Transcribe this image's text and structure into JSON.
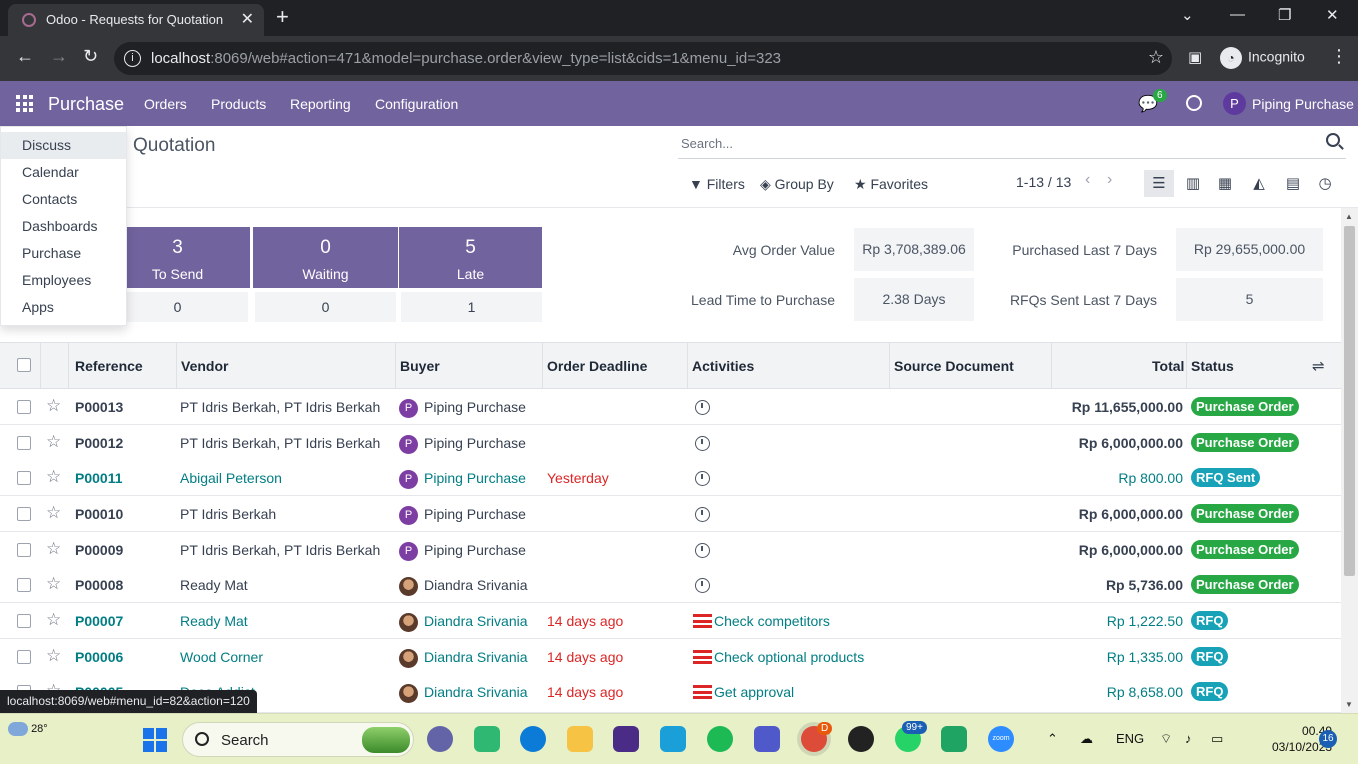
{
  "browser": {
    "tab_title": "Odoo - Requests for Quotation",
    "url_host": "localhost",
    "url_rest": ":8069/web#action=471&model=purchase.order&view_type=list&cids=1&menu_id=323",
    "profile_label": "Incognito",
    "link_preview": "localhost:8069/web#menu_id=82&action=120"
  },
  "navbar": {
    "app_name": "Purchase",
    "menu": [
      "Orders",
      "Products",
      "Reporting",
      "Configuration"
    ],
    "chat_count": "6",
    "user_initial": "P",
    "user_name": "Piping Purchase"
  },
  "apps_dropdown": [
    "Discuss",
    "Calendar",
    "Contacts",
    "Dashboards",
    "Purchase",
    "Employees",
    "Apps"
  ],
  "control_panel": {
    "title": "Quotation",
    "search_placeholder": "Search...",
    "filters": "Filters",
    "group_by": "Group By",
    "favorites": "Favorites",
    "pager": "1-13 / 13"
  },
  "dashboard": {
    "tiles": [
      {
        "value": "3",
        "label": "To Send",
        "sub": "0"
      },
      {
        "value": "0",
        "label": "Waiting",
        "sub": "0"
      },
      {
        "value": "5",
        "label": "Late",
        "sub": "1"
      }
    ],
    "kpis": [
      {
        "label": "Avg Order Value",
        "value": "Rp 3,708,389.06"
      },
      {
        "label": "Purchased Last 7 Days",
        "value": "Rp 29,655,000.00"
      },
      {
        "label": "Lead Time to Purchase",
        "value": "2.38 Days"
      },
      {
        "label": "RFQs Sent Last 7 Days",
        "value": "5"
      }
    ]
  },
  "table": {
    "columns": [
      "Reference",
      "Vendor",
      "Buyer",
      "Order Deadline",
      "Activities",
      "Source Document",
      "Total",
      "Status"
    ],
    "rows": [
      {
        "ref": "P00013",
        "vendor": "PT Idris Berkah, PT Idris Berkah",
        "buyer": "Piping Purchase",
        "deadline": "",
        "activity": "",
        "total": "Rp 11,655,000.00",
        "status": "Purchase Order"
      },
      {
        "ref": "P00012",
        "vendor": "PT Idris Berkah, PT Idris Berkah",
        "buyer": "Piping Purchase",
        "deadline": "",
        "activity": "",
        "total": "Rp 6,000,000.00",
        "status": "Purchase Order"
      },
      {
        "ref": "P00011",
        "vendor": "Abigail Peterson",
        "buyer": "Piping Purchase",
        "deadline": "Yesterday",
        "activity": "",
        "total": "Rp 800.00",
        "status": "RFQ Sent"
      },
      {
        "ref": "P00010",
        "vendor": "PT Idris Berkah",
        "buyer": "Piping Purchase",
        "deadline": "",
        "activity": "",
        "total": "Rp 6,000,000.00",
        "status": "Purchase Order"
      },
      {
        "ref": "P00009",
        "vendor": "PT Idris Berkah, PT Idris Berkah",
        "buyer": "Piping Purchase",
        "deadline": "",
        "activity": "",
        "total": "Rp 6,000,000.00",
        "status": "Purchase Order"
      },
      {
        "ref": "P00008",
        "vendor": "Ready Mat",
        "buyer": "Diandra Srivania",
        "deadline": "",
        "activity": "",
        "total": "Rp 5,736.00",
        "status": "Purchase Order"
      },
      {
        "ref": "P00007",
        "vendor": "Ready Mat",
        "buyer": "Diandra Srivania",
        "deadline": "14 days ago",
        "activity": "Check competitors",
        "total": "Rp 1,222.50",
        "status": "RFQ"
      },
      {
        "ref": "P00006",
        "vendor": "Wood Corner",
        "buyer": "Diandra Srivania",
        "deadline": "14 days ago",
        "activity": "Check optional products",
        "total": "Rp 1,335.00",
        "status": "RFQ"
      },
      {
        "ref": "P00005",
        "vendor": "Deco Addict",
        "buyer": "Diandra Srivania",
        "deadline": "14 days ago",
        "activity": "Get approval",
        "total": "Rp 8,658.00",
        "status": "RFQ"
      }
    ]
  },
  "taskbar": {
    "temperature": "28°",
    "search_label": "Search",
    "zoom_label": "zoom",
    "lang": "ENG",
    "time": "00.49",
    "date": "03/10/2023",
    "notifications": "16",
    "whatsapp_badge": "99+",
    "chrome_badge": "D"
  }
}
